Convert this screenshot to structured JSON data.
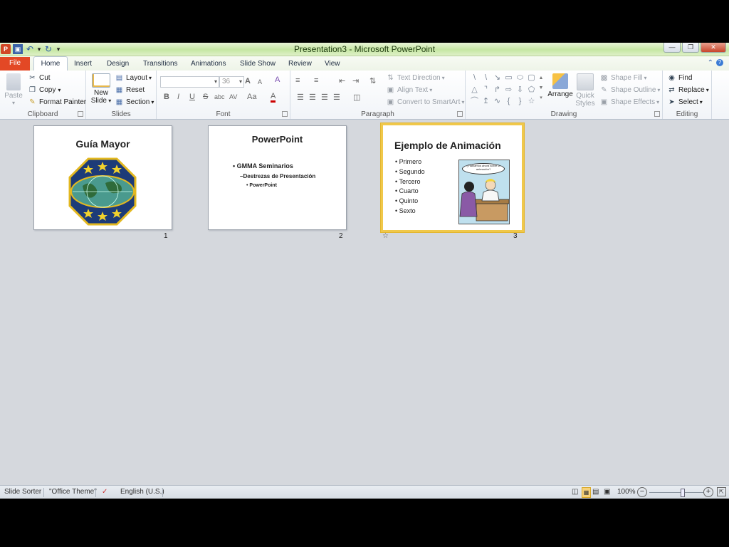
{
  "window": {
    "title": "Presentation3 - Microsoft PowerPoint"
  },
  "tabs": [
    "File",
    "Home",
    "Insert",
    "Design",
    "Transitions",
    "Animations",
    "Slide Show",
    "Review",
    "View"
  ],
  "ribbon": {
    "clipboard": {
      "label": "Clipboard",
      "paste": "Paste",
      "cut": "Cut",
      "copy": "Copy",
      "format_painter": "Format Painter"
    },
    "slides": {
      "label": "Slides",
      "new_slide_line1": "New",
      "new_slide_line2": "Slide",
      "layout": "Layout",
      "reset": "Reset",
      "section": "Section"
    },
    "font": {
      "label": "Font",
      "font_size": "36",
      "font_size_icon": "A",
      "font_size_down_icon": "A",
      "clear_icon": "A",
      "bold": "B",
      "italic": "I",
      "underline": "U",
      "strike": "S",
      "shadow": "abc",
      "spacing": "AV",
      "case": "Aa",
      "color": "A"
    },
    "paragraph": {
      "label": "Paragraph",
      "text_direction": "Text Direction",
      "align_text": "Align Text",
      "convert_smartart": "Convert to SmartArt"
    },
    "drawing": {
      "label": "Drawing",
      "arrange": "Arrange",
      "quick_styles_line1": "Quick",
      "quick_styles_line2": "Styles",
      "shape_fill": "Shape Fill",
      "shape_outline": "Shape Outline",
      "shape_effects": "Shape Effects"
    },
    "editing": {
      "label": "Editing",
      "find": "Find",
      "replace": "Replace",
      "select": "Select"
    }
  },
  "slides": [
    {
      "number": "1",
      "title": "Guía Mayor"
    },
    {
      "number": "2",
      "title": "PowerPoint",
      "bullets": [
        {
          "level": 1,
          "text": "GMMA  Seminarios"
        },
        {
          "level": 2,
          "text": "Destrezas de Presentación"
        },
        {
          "level": 3,
          "text": "PowerPoint"
        }
      ]
    },
    {
      "number": "3",
      "title": "Ejemplo de Animación",
      "bullets": [
        "Primero",
        "Segundo",
        "Tercero",
        "Cuarto",
        "Quinto",
        "Sexto"
      ],
      "comic_caption": "¿Hablamos ahora sobre la animación?",
      "selected": true
    }
  ],
  "status": {
    "view": "Slide Sorter",
    "theme": "\"Office Theme\"",
    "language": "English (U.S.)",
    "zoom": "100%",
    "zoom_level_pct": 100
  },
  "colors": {
    "file_tab": "#e34825",
    "selection": "#f0c84a",
    "title_bar": "#c6e7a3",
    "workspace": "#d5d8dd"
  }
}
